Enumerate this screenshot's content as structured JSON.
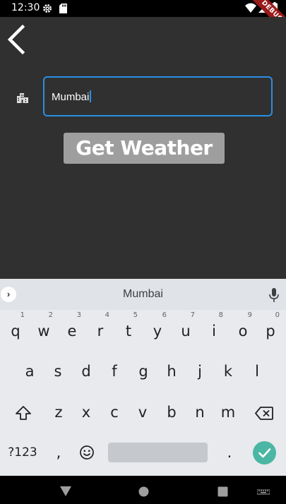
{
  "status_bar": {
    "time": "12:30",
    "icons": [
      "settings-icon",
      "sd-card-icon",
      "wifi-icon",
      "signal-icon",
      "battery-icon"
    ],
    "debug_banner": "DEBUG"
  },
  "app": {
    "back_icon": "back-arrow-icon",
    "city_icon": "location-city-icon",
    "city_input_value": "Mumbai",
    "get_weather_label": "Get Weather",
    "colors": {
      "background": "#303030",
      "focus_border": "#2a8fe4",
      "button_bg": "#9e9e9e"
    }
  },
  "keyboard": {
    "suggestion": "Mumbai",
    "row1": [
      {
        "key": "q",
        "hint": "1"
      },
      {
        "key": "w",
        "hint": "2"
      },
      {
        "key": "e",
        "hint": "3"
      },
      {
        "key": "r",
        "hint": "4"
      },
      {
        "key": "t",
        "hint": "5"
      },
      {
        "key": "y",
        "hint": "6"
      },
      {
        "key": "u",
        "hint": "7"
      },
      {
        "key": "i",
        "hint": "8"
      },
      {
        "key": "o",
        "hint": "9"
      },
      {
        "key": "p",
        "hint": "0"
      }
    ],
    "row2": [
      "a",
      "s",
      "d",
      "f",
      "g",
      "h",
      "j",
      "k",
      "l"
    ],
    "row3": [
      "z",
      "x",
      "c",
      "v",
      "b",
      "n",
      "m"
    ],
    "symbols_label": "?123",
    "comma": ",",
    "period": ".",
    "colors": {
      "accent": "#4cb6a4",
      "background": "#e8eaed"
    }
  },
  "nav_bar": {
    "icons": [
      "back-triangle-icon",
      "home-circle-icon",
      "recents-square-icon",
      "keyboard-switch-icon"
    ]
  }
}
